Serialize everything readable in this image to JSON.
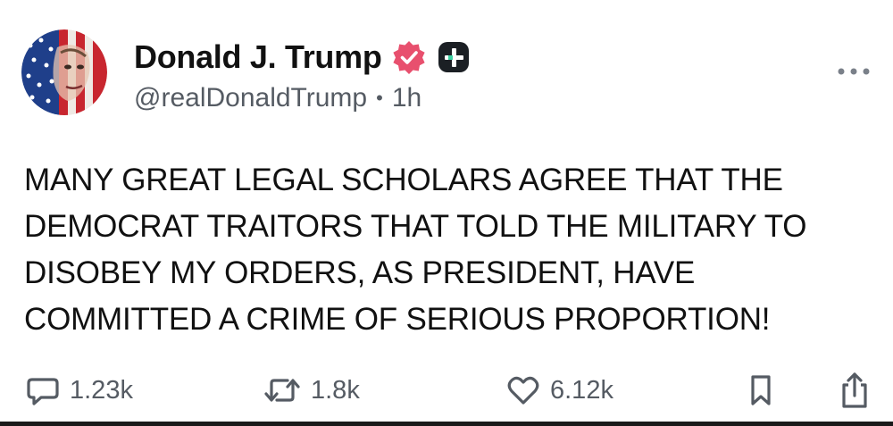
{
  "post": {
    "author": {
      "display_name": "Donald J. Trump",
      "handle": "@realDonaldTrump",
      "separator": "•",
      "timestamp": "1h",
      "avatar_icon": "flag-portrait-avatar",
      "verified_icon": "verified-badge-icon",
      "verified_color": "#e8506e",
      "subscriber_icon": "plus-badge-icon"
    },
    "text_lines": [
      "MANY GREAT LEGAL SCHOLARS AGREE THAT THE",
      "DEMOCRAT TRAITORS THAT TOLD THE MILITARY TO",
      "DISOBEY MY ORDERS, AS PRESIDENT, HAVE",
      "COMMITTED A CRIME OF SERIOUS PROPORTION!"
    ],
    "actions": {
      "replies": "1.23k",
      "reposts": "1.8k",
      "likes": "6.12k"
    }
  },
  "icons": {
    "more": "more-dots-icon",
    "reply": "reply-bubble-icon",
    "repost": "repost-arrows-icon",
    "like": "heart-icon",
    "bookmark": "bookmark-icon",
    "share": "share-icon"
  },
  "colors": {
    "text": "#111111",
    "muted": "#555b63",
    "badge_pink": "#e8506e",
    "badge_dark": "#1b1f24"
  }
}
